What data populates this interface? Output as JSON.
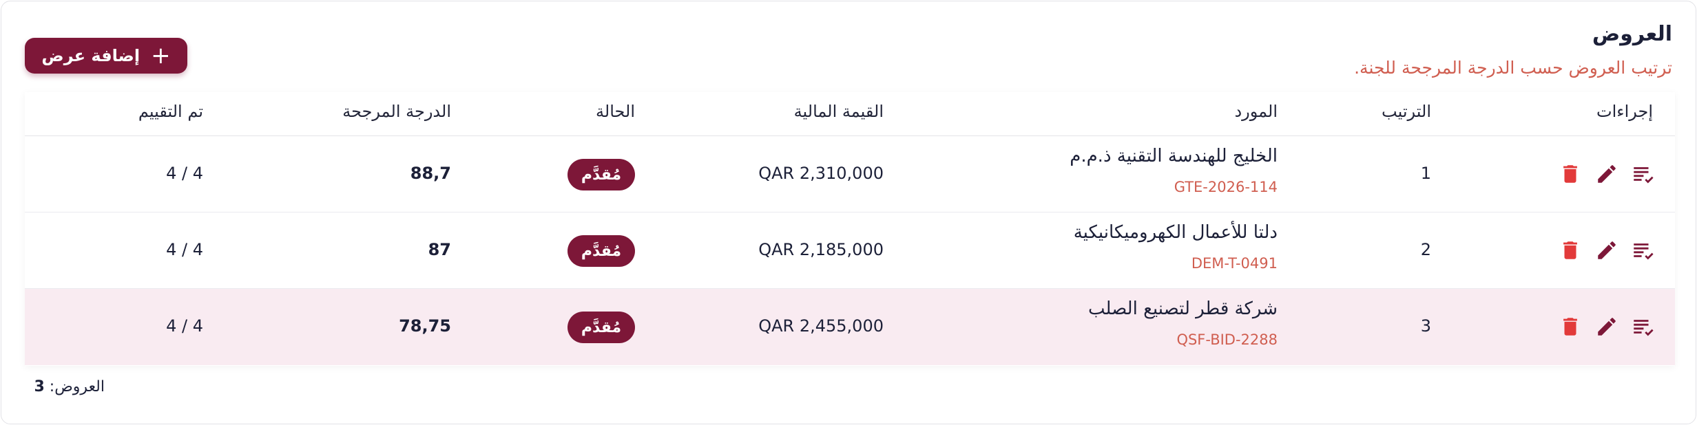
{
  "header": {
    "title": "العروض",
    "subtitle": "ترتيب العروض حسب الدرجة المرجحة للجنة.",
    "add_button_label": "إضافة عرض"
  },
  "table": {
    "columns": {
      "actions": "إجراءات",
      "rank": "الترتيب",
      "supplier": "المورد",
      "financial_value": "القيمة المالية",
      "status": "الحالة",
      "weighted_score": "الدرجة المرجحة",
      "evaluated": "تم التقييم"
    },
    "rows": [
      {
        "rank": "1",
        "supplier_name": "الخليج للهندسة التقنية ذ.م.م",
        "supplier_code": "GTE-2026-114",
        "financial_value": "QAR 2,310,000",
        "status": "مُقدَّم",
        "weighted_score": "88,7",
        "evaluated": "4 / 4"
      },
      {
        "rank": "2",
        "supplier_name": "دلتا للأعمال الكهروميكانيكية",
        "supplier_code": "DEM-T-0491",
        "financial_value": "QAR 2,185,000",
        "status": "مُقدَّم",
        "weighted_score": "87",
        "evaluated": "4 / 4"
      },
      {
        "rank": "3",
        "supplier_name": "شركة قطر لتصنيع الصلب",
        "supplier_code": "QSF-BID-2288",
        "financial_value": "QAR 2,455,000",
        "status": "مُقدَّم",
        "weighted_score": "78,75",
        "evaluated": "4 / 4"
      }
    ]
  },
  "footer": {
    "label": "العروض:",
    "count": "3"
  },
  "colors": {
    "brand": "#7d1738",
    "accent_text": "#d05e50",
    "delete_icon": "#e23a3a",
    "highlight_row": "#f9ebf1"
  },
  "icons": {
    "add": "plus-icon",
    "evaluate": "checklist-icon",
    "edit": "pencil-icon",
    "delete": "trash-icon"
  }
}
